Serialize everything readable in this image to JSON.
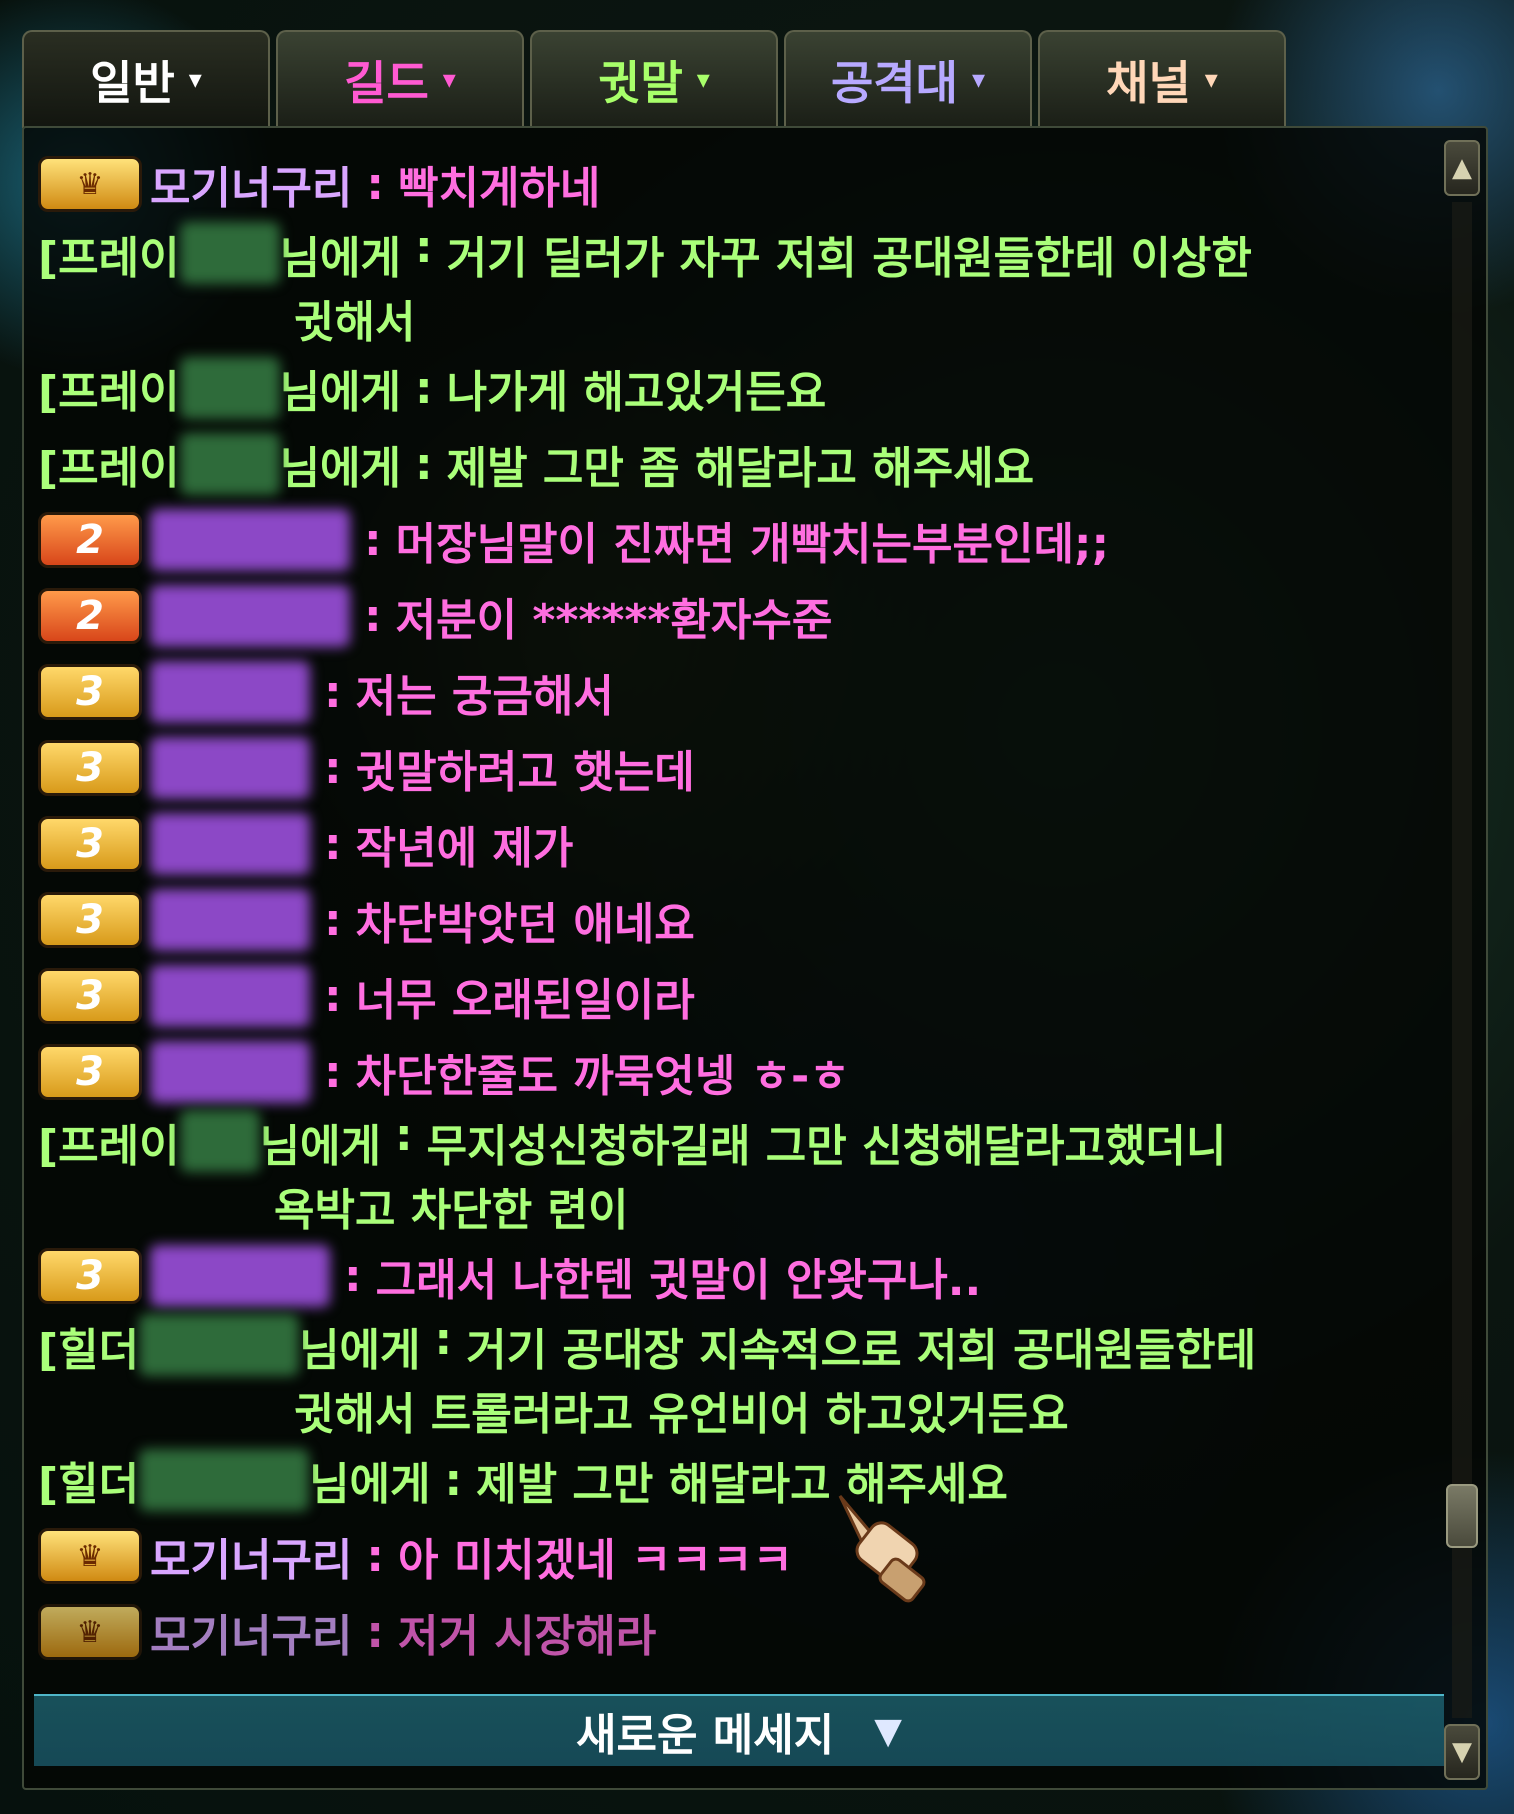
{
  "tabs": [
    {
      "label": "일반",
      "caret": "▾"
    },
    {
      "label": "길드",
      "caret": "▾"
    },
    {
      "label": "귓말",
      "caret": "▾"
    },
    {
      "label": "공격대",
      "caret": "▾"
    },
    {
      "label": "채널",
      "caret": "▾"
    }
  ],
  "messages": {
    "m1": {
      "badge": "crown-icon",
      "name": "모기너구리",
      "sep": ":",
      "text": "빡치게하네"
    },
    "m2": {
      "prefix": "[프레이",
      "to": "님에게",
      "sep": ":",
      "text": "거기 딜러가 자꾸 저희 공대원들한테 이상한",
      "cont": "귓해서"
    },
    "m3": {
      "prefix": "[프레이",
      "to": "님에게",
      "sep": ":",
      "text": "나가게 해고있거든요"
    },
    "m4": {
      "prefix": "[프레이",
      "to": "님에게",
      "sep": ":",
      "text": "제발 그만 좀 해달라고 해주세요"
    },
    "m5": {
      "badge": "2",
      "sep": ":",
      "text": "머장님말이 진짜면 개빡치는부분인데;;"
    },
    "m6": {
      "badge": "2",
      "sep": ":",
      "text": "저분이 ******환자수준"
    },
    "m7": {
      "badge": "3",
      "sep": ":",
      "text": "저는 궁금해서"
    },
    "m8": {
      "badge": "3",
      "sep": ":",
      "text": "귓말하려고 햇는데"
    },
    "m9": {
      "badge": "3",
      "sep": ":",
      "text": "작년에 제가"
    },
    "m10": {
      "badge": "3",
      "sep": ":",
      "text": "차단박앗던 애네요"
    },
    "m11": {
      "badge": "3",
      "sep": ":",
      "text": "너무 오래된일이라"
    },
    "m12": {
      "badge": "3",
      "sep": ":",
      "text": "차단한줄도 까묵엇넹 ㅎ-ㅎ"
    },
    "m13": {
      "prefix": "[프레이",
      "to": "님에게",
      "sep": ":",
      "text": "무지성신청하길래 그만 신청해달라고했더니",
      "cont": "욕박고 차단한 련이"
    },
    "m14": {
      "badge": "3",
      "sep": ":",
      "text": "그래서 나한텐 귓말이 안왓구나.."
    },
    "m15": {
      "prefix": "[힐더",
      "to": "님에게",
      "sep": ":",
      "text": "거기 공대장 지속적으로 저희 공대원들한테",
      "cont": "귓해서 트롤러라고 유언비어 하고있거든요"
    },
    "m16": {
      "prefix": "[힐더",
      "to": "님에게",
      "sep": ":",
      "text": "제발 그만 해달라고 해주세요"
    },
    "m17": {
      "badge": "crown-icon",
      "name": "모기너구리",
      "sep": ":",
      "text": "아 미치겠네 ㅋㅋㅋㅋ"
    },
    "m18": {
      "badge": "crown-icon",
      "name": "모기너구리",
      "sep": ":",
      "text": "저거 시장해라"
    }
  },
  "new_message": {
    "label": "새로운 메세지",
    "arrow": "▼"
  },
  "scroll": {
    "up": "▲",
    "down": "▼"
  },
  "colors": {
    "guild_text": "#ff6ee0",
    "guild_name": "#d9a6ff",
    "whisper_text": "#aaff7a",
    "tab_guild": "#ff5ad2",
    "tab_whisper": "#a8ff6a",
    "tab_raid": "#b7a9ff",
    "new_message_bar": "#2e8fa3"
  }
}
